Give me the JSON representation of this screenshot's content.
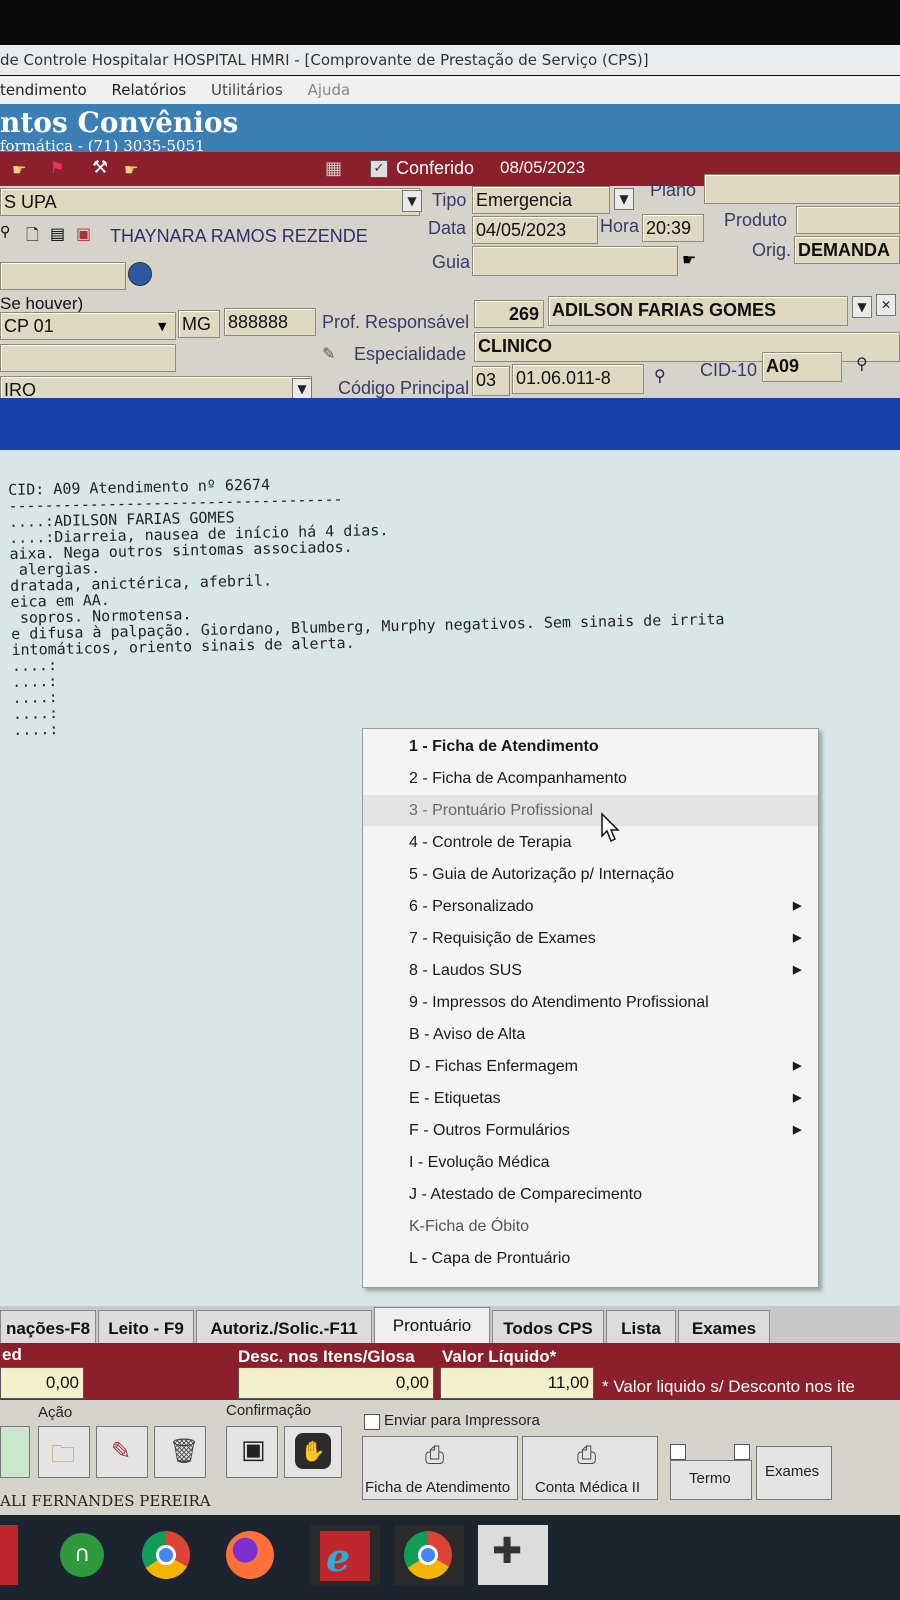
{
  "window": {
    "title": "de Controle Hospitalar HOSPITAL HMRI - [Comprovante de Prestação de Serviço  (CPS)]"
  },
  "menubar": [
    "tendimento",
    "Relatórios",
    "Utilitários",
    "Ajuda"
  ],
  "banner": {
    "title": "ntos Convênios",
    "subtitle": "formática - (71) 3035-5051"
  },
  "conferido": {
    "label": "Conferido",
    "date": "08/05/2023"
  },
  "form": {
    "unit": "S UPA",
    "tipo_label": "Tipo",
    "tipo_value": "Emergencia",
    "plano_label": "Plano",
    "plano_value": "",
    "data_label": "Data",
    "data_value": "04/05/2023",
    "hora_label": "Hora",
    "hora_value": "20:39",
    "produto_label": "Produto",
    "produto_value": "",
    "orig_label": "Orig.",
    "orig_value": "DEMANDA",
    "guia_label": "Guia",
    "guia_value": "",
    "patient_name": "THAYNARA RAMOS REZENDE",
    "se_houver": "Se houver)",
    "cp_value": "CP 01",
    "uf_value": "MG",
    "crm_value": "888888",
    "prof_label": "Prof. Responsável",
    "prof_code": "269",
    "prof_name": "ADILSON FARIAS GOMES",
    "espec_label": "Especialidade",
    "espec_value": "CLINICO",
    "codprinc_label": "Código Principal",
    "codprinc_prefix": "03",
    "codprinc_value": "01.06.011-8",
    "cid_label": "CID-10",
    "cid_value": "A09",
    "iro_value": "IRO"
  },
  "record": {
    "lines": [
      "CID: A09 Atendimento nº 62674",
      "-------------------------------------",
      "....:ADILSON FARIAS GOMES",
      "....:Diarreia, nausea de início há 4 dias.",
      "aixa. Nega outros sintomas associados.",
      " alergias.",
      "",
      "dratada, anictérica, afebril.",
      "eica em AA.",
      " sopros. Normotensa.",
      "e difusa à palpação. Giordano, Blumberg, Murphy negativos. Sem sinais de irrita",
      "intomáticos, oriento sinais de alerta.",
      "",
      "....:",
      "....:",
      "....:",
      "",
      "....:",
      "....:"
    ]
  },
  "context_menu": {
    "items": [
      {
        "label": "1 - Ficha de Atendimento",
        "submenu": false
      },
      {
        "label": "2 - Ficha de Acompanhamento",
        "submenu": false
      },
      {
        "label": "3 - Prontuário Profissional",
        "submenu": false
      },
      {
        "label": "4 - Controle de Terapia",
        "submenu": false
      },
      {
        "label": "5 - Guia de Autorização p/ Internação",
        "submenu": false
      },
      {
        "label": "6 - Personalizado",
        "submenu": true
      },
      {
        "label": "7 - Requisição de Exames",
        "submenu": true
      },
      {
        "label": "8 - Laudos SUS",
        "submenu": true
      },
      {
        "label": "9 - Impressos do Atendimento Profissional",
        "submenu": false
      },
      {
        "label": "B - Aviso de Alta",
        "submenu": false
      },
      {
        "label": "D - Fichas Enfermagem",
        "submenu": true
      },
      {
        "label": "E - Etiquetas",
        "submenu": true
      },
      {
        "label": "F - Outros Formulários",
        "submenu": true
      },
      {
        "label": "I - Evolução Médica",
        "submenu": false
      },
      {
        "label": "J - Atestado de Comparecimento",
        "submenu": false
      },
      {
        "label": "K-Ficha de Óbito",
        "submenu": false
      },
      {
        "label": "L - Capa de Prontuário",
        "submenu": false
      }
    ]
  },
  "tabs": [
    "nações-F8",
    "Leito - F9",
    "Autoriz./Solic.-F11",
    "Prontuário",
    "Todos CPS",
    "Lista",
    "Exames"
  ],
  "totals": {
    "left_label": "ed",
    "left_value": "0,00",
    "desc_label": "Desc. nos Itens/Glosa",
    "desc_value": "0,00",
    "liquido_label": "Valor Líquido*",
    "liquido_value": "11,00",
    "note": "* Valor liquido s/ Desconto nos ite"
  },
  "actions": {
    "acao_label": "Ação",
    "confirmacao_label": "Confirmação",
    "enviar_label": "Enviar para Impressora",
    "ficha_btn": "Ficha de Atendimento",
    "conta_btn": "Conta Médica II",
    "termo_btn": "Termo",
    "exames_btn": "Exames",
    "user": "ALI FERNANDES PEREIRA"
  },
  "colors": {
    "banner_blue": "#3c7fb5",
    "header_red": "#8b1f2b",
    "band_blue": "#1b3fa8",
    "record_bg": "#d8e6e8"
  }
}
